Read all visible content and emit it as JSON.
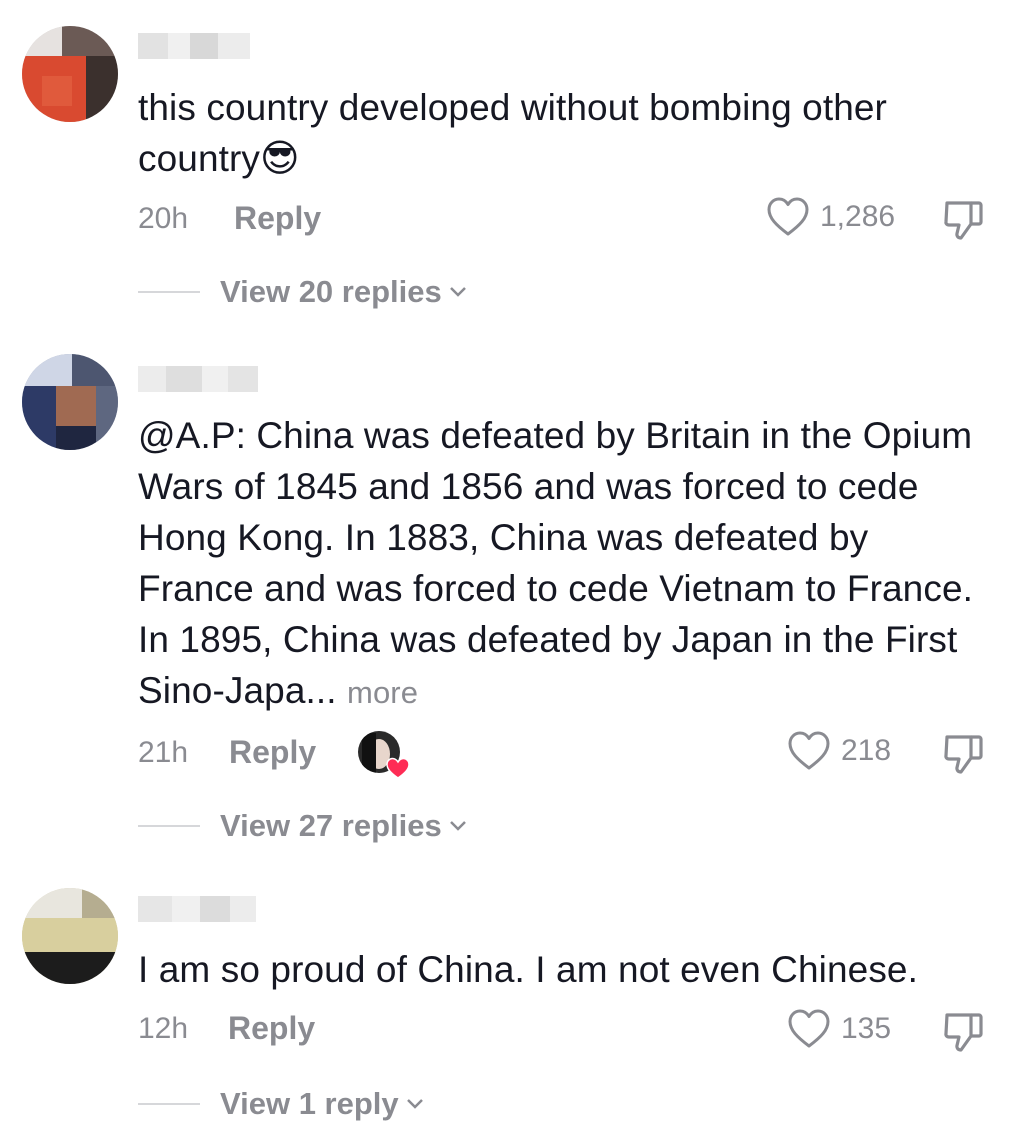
{
  "comments": [
    {
      "text": "this country developed without bombing other country",
      "emoji": "😎",
      "time": "20h",
      "reply_label": "Reply",
      "likes": "1,286",
      "view_replies": "View 20 replies"
    },
    {
      "text": "@A.P: China was defeated by Britain in the Opium Wars of 1845 and 1856 and was forced to cede Hong Kong. In 1883, China was defeated by France and was forced to cede Vietnam to France. In 1895, China was defeated by Japan in the First Sino-Japa...",
      "more_label": "more",
      "time": "21h",
      "reply_label": "Reply",
      "likes": "218",
      "view_replies": "View 27 replies"
    },
    {
      "text": "I am so proud of China. I am not even Chinese.",
      "time": "12h",
      "reply_label": "Reply",
      "likes": "135",
      "view_replies": "View 1 reply"
    }
  ],
  "colors": {
    "text": "#161823",
    "secondary": "#8a8b91",
    "creator_heart": "#fe2c55"
  }
}
